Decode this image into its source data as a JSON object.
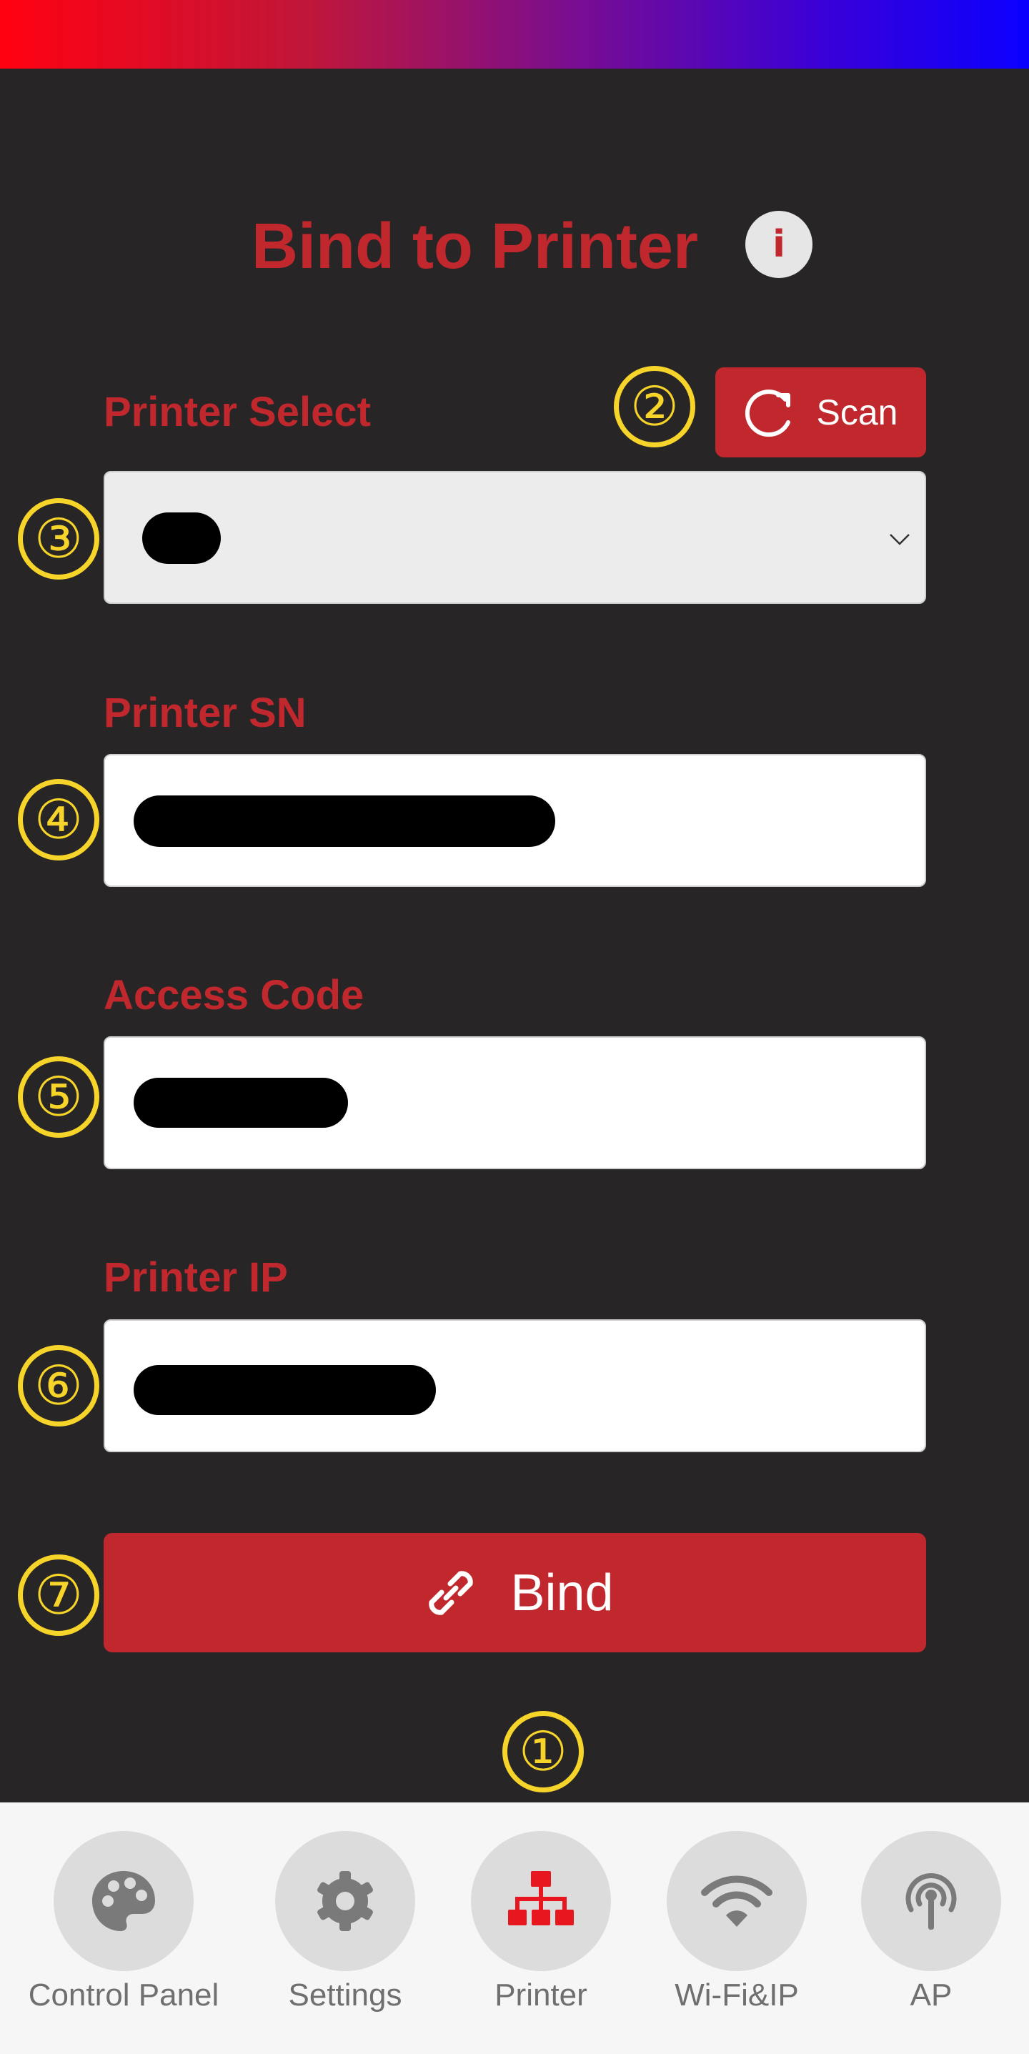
{
  "header": {
    "gradient": [
      "#ff0010",
      "#0a00ff"
    ]
  },
  "page": {
    "title": "Bind to Printer",
    "info_icon": "i"
  },
  "form": {
    "printer_select": {
      "label": "Printer Select",
      "value": "",
      "redacted": true
    },
    "scan_button": {
      "label": "Scan",
      "icon": "refresh-icon"
    },
    "printer_sn": {
      "label": "Printer SN",
      "value": "",
      "redacted": true
    },
    "access_code": {
      "label": "Access Code",
      "value": "",
      "redacted": true
    },
    "printer_ip": {
      "label": "Printer IP",
      "value": "",
      "redacted": true
    },
    "bind_button": {
      "label": "Bind",
      "icon": "link-icon"
    }
  },
  "annotations": [
    "①",
    "②",
    "③",
    "④",
    "⑤",
    "⑥",
    "⑦"
  ],
  "bottom_nav": {
    "active": "Printer",
    "items": [
      {
        "label": "Control Panel",
        "icon": "palette-icon"
      },
      {
        "label": "Settings",
        "icon": "gear-icon"
      },
      {
        "label": "Printer",
        "icon": "network-tree-icon"
      },
      {
        "label": "Wi-Fi&IP",
        "icon": "wifi-icon"
      },
      {
        "label": "AP",
        "icon": "antenna-icon"
      }
    ]
  },
  "colors": {
    "accent": "#c0282e",
    "background": "#272526",
    "annotation": "#f6d42a",
    "nav_background": "#f6f6f6"
  }
}
